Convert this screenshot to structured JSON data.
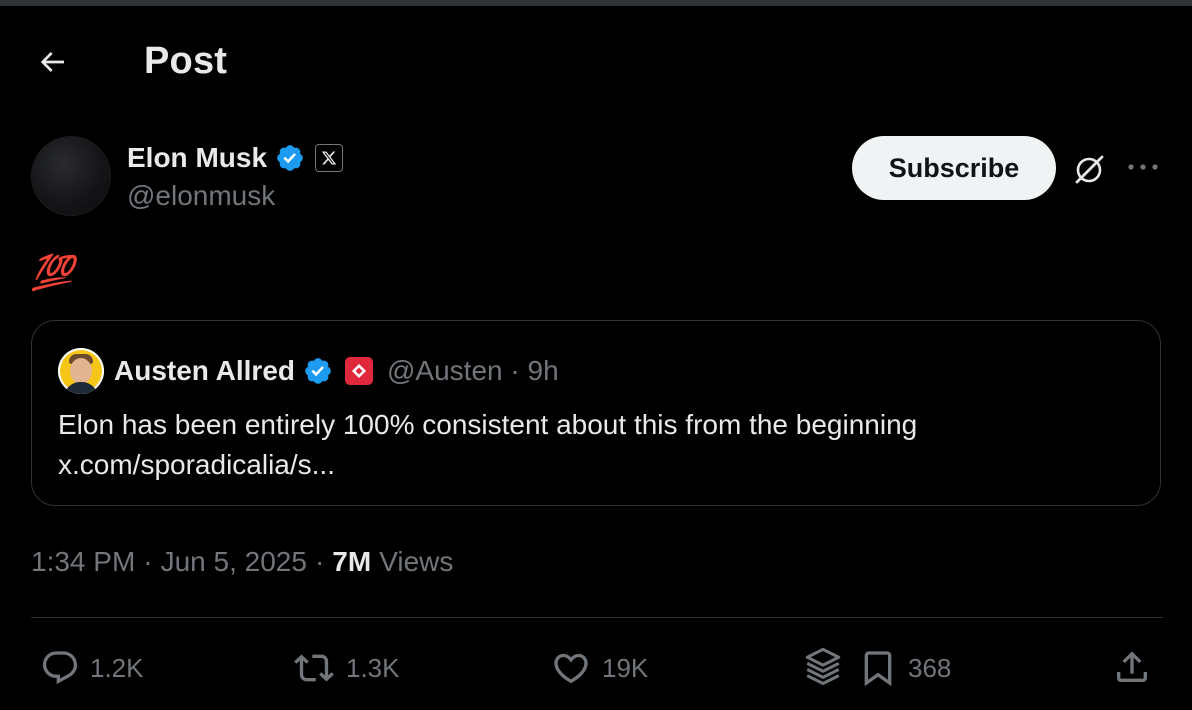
{
  "header": {
    "title": "Post",
    "back_icon": "arrow-left-icon"
  },
  "post": {
    "author": {
      "name": "Elon Musk",
      "handle": "@elonmusk",
      "verified_color": "#1d9bf0",
      "affiliation_badge": "x-logo-icon"
    },
    "subscribe_label": "Subscribe",
    "text_emoji": "💯",
    "quote": {
      "name": "Austen Allred",
      "handle": "@Austen",
      "separator": "·",
      "time_ago": "9h",
      "text": "Elon has been entirely 100% consistent about this from the beginning",
      "link": "x.com/sporadicalia/s..."
    },
    "meta": {
      "time": "1:34 PM",
      "date": "Jun 5, 2025",
      "views_count": "7M",
      "views_label": "Views"
    },
    "actions": {
      "replies": "1.2K",
      "reposts": "1.3K",
      "likes": "19K",
      "bookmarks": "368"
    }
  },
  "colors": {
    "background": "#000000",
    "text": "#e7e9ea",
    "muted": "#71767b",
    "accent": "#1d9bf0",
    "border": "#2f3336"
  }
}
